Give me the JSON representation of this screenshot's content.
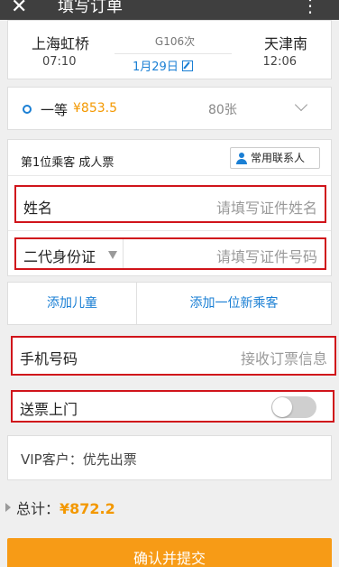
{
  "header": {
    "close": "✕",
    "title": "填写订单",
    "more": "⋮"
  },
  "trip": {
    "from_station": "上海虹桥",
    "from_time": "07:10",
    "train_no": "G106次",
    "date": "1月29日",
    "to_station": "天津南",
    "to_time": "12:06"
  },
  "seat": {
    "class": "一等",
    "price": "¥853.5",
    "count": "80张"
  },
  "passenger": {
    "title": "第1位乘客 成人票",
    "contact_button": "常用联系人",
    "name_label": "姓名",
    "name_placeholder": "请填写证件姓名",
    "id_type": "二代身份证",
    "id_placeholder": "请填写证件号码"
  },
  "actions": {
    "add_child": "添加儿童",
    "add_adult": "添加一位新乘客"
  },
  "phone": {
    "label": "手机号码",
    "placeholder": "接收订票信息"
  },
  "delivery": {
    "label": "送票上门",
    "enabled": false
  },
  "vip": {
    "text": "VIP客户：优先出票"
  },
  "total": {
    "label": "总计：",
    "amount": "¥872.2"
  },
  "submit": {
    "label": "确认并提交"
  },
  "colors": {
    "accent": "#1a7fd4",
    "price": "#f39800",
    "submit": "#f79b16",
    "highlight": "#d0141b"
  }
}
